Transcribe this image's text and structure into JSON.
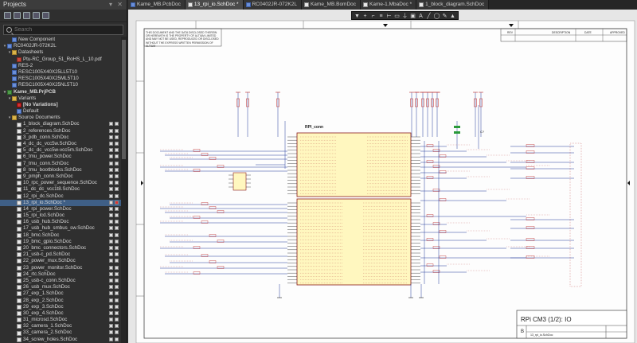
{
  "panel": {
    "title": "Projects",
    "search_placeholder": "Search",
    "rows": [
      {
        "text": "New Component",
        "indent": 1,
        "icon": "comp",
        "exp": ""
      },
      {
        "text": "RC0402JR-072K2L",
        "indent": 0,
        "icon": "comp",
        "exp": "▾"
      },
      {
        "text": "Datasheets",
        "indent": 1,
        "icon": "folder",
        "exp": "▾"
      },
      {
        "text": "Ptu-RC_Group_51_RoHS_L_10.pdf",
        "indent": 2,
        "icon": "pdf",
        "exp": ""
      },
      {
        "text": "RES-2",
        "indent": 1,
        "icon": "comp",
        "exp": ""
      },
      {
        "text": "RESC1005X40X25LL5T10",
        "indent": 1,
        "icon": "comp",
        "exp": ""
      },
      {
        "text": "RESC1005X40X25ML5T10",
        "indent": 1,
        "icon": "comp",
        "exp": ""
      },
      {
        "text": "RESC1005X40X25NL5T10",
        "indent": 1,
        "icon": "comp",
        "exp": ""
      },
      {
        "text": "Kame_MB.PrjPCB",
        "indent": 0,
        "icon": "proj",
        "exp": "▾",
        "proj": true
      },
      {
        "text": "Variants",
        "indent": 1,
        "icon": "folder",
        "exp": "▾"
      },
      {
        "text": "[No Variations]",
        "indent": 2,
        "icon": "red",
        "exp": "",
        "bold": true
      },
      {
        "text": "Default",
        "indent": 2,
        "icon": "comp",
        "exp": ""
      },
      {
        "text": "Source Documents",
        "indent": 1,
        "icon": "folder",
        "exp": "▾"
      },
      {
        "text": "1_block_diagram.SchDoc",
        "indent": 2,
        "icon": "doc",
        "flags": true
      },
      {
        "text": "2_references.SchDoc",
        "indent": 2,
        "icon": "doc",
        "flags": true
      },
      {
        "text": "3_pdb_conn.SchDoc",
        "indent": 2,
        "icon": "doc",
        "flags": true
      },
      {
        "text": "4_dc_dc_vcc5w.SchDoc",
        "indent": 2,
        "icon": "doc",
        "flags": true
      },
      {
        "text": "5_dc_dc_vcc5w-vcc5m.SchDoc",
        "indent": 2,
        "icon": "doc",
        "flags": true
      },
      {
        "text": "6_tmu_power.SchDoc",
        "indent": 2,
        "icon": "doc",
        "flags": true
      },
      {
        "text": "7_tmu_conn.SchDoc",
        "indent": 2,
        "icon": "doc",
        "flags": true
      },
      {
        "text": "8_tmu_bootblocks.SchDoc",
        "indent": 2,
        "icon": "doc",
        "flags": true
      },
      {
        "text": "9_pmph_conn.SchDoc",
        "indent": 2,
        "icon": "doc",
        "flags": true
      },
      {
        "text": "10_rpc_power_sequence.SchDoc",
        "indent": 2,
        "icon": "doc",
        "flags": true
      },
      {
        "text": "11_dc_dc_vcc1t8.SchDoc",
        "indent": 2,
        "icon": "doc",
        "flags": true
      },
      {
        "text": "12_rpi_dc.SchDoc",
        "indent": 2,
        "icon": "doc",
        "flags": true
      },
      {
        "text": "13_rpi_io.SchDoc *",
        "indent": 2,
        "icon": "doc",
        "flags": true,
        "sel": true
      },
      {
        "text": "14_rpi_power.SchDoc",
        "indent": 2,
        "icon": "doc",
        "flags": true
      },
      {
        "text": "15_rpi_lcd.SchDoc",
        "indent": 2,
        "icon": "doc",
        "flags": true
      },
      {
        "text": "16_usb_hub.SchDoc",
        "indent": 2,
        "icon": "doc",
        "flags": true
      },
      {
        "text": "17_usb_hub_smbus_sw.SchDoc",
        "indent": 2,
        "icon": "doc",
        "flags": true
      },
      {
        "text": "18_bmc.SchDoc",
        "indent": 2,
        "icon": "doc",
        "flags": true
      },
      {
        "text": "19_bmc_gpio.SchDoc",
        "indent": 2,
        "icon": "doc",
        "flags": true
      },
      {
        "text": "20_bmc_connectors.SchDoc",
        "indent": 2,
        "icon": "doc",
        "flags": true
      },
      {
        "text": "21_usb-c_pd.SchDoc",
        "indent": 2,
        "icon": "doc",
        "flags": true
      },
      {
        "text": "22_power_mux.SchDoc",
        "indent": 2,
        "icon": "doc",
        "flags": true
      },
      {
        "text": "23_power_monitor.SchDoc",
        "indent": 2,
        "icon": "doc",
        "flags": true
      },
      {
        "text": "24_rtc.SchDoc",
        "indent": 2,
        "icon": "doc",
        "flags": true
      },
      {
        "text": "25_usb-c_conn.SchDoc",
        "indent": 2,
        "icon": "doc",
        "flags": true
      },
      {
        "text": "26_usb_mux.SchDoc",
        "indent": 2,
        "icon": "doc",
        "flags": true
      },
      {
        "text": "27_exp_1.SchDoc",
        "indent": 2,
        "icon": "doc",
        "flags": true
      },
      {
        "text": "28_exp_2.SchDoc",
        "indent": 2,
        "icon": "doc",
        "flags": true
      },
      {
        "text": "29_exp_3.SchDoc",
        "indent": 2,
        "icon": "doc",
        "flags": true
      },
      {
        "text": "30_exp_4.SchDoc",
        "indent": 2,
        "icon": "doc",
        "flags": true
      },
      {
        "text": "31_microsd.SchDoc",
        "indent": 2,
        "icon": "doc",
        "flags": true
      },
      {
        "text": "32_camera_1.SchDoc",
        "indent": 2,
        "icon": "doc",
        "flags": true
      },
      {
        "text": "33_camera_2.SchDoc",
        "indent": 2,
        "icon": "doc",
        "flags": true
      },
      {
        "text": "34_screw_holes.SchDoc",
        "indent": 2,
        "icon": "doc",
        "flags": true
      }
    ]
  },
  "tabs": [
    {
      "label": "Kame_MB.PcbDoc",
      "icon": "comp"
    },
    {
      "label": "13_rpi_io.SchDoc *",
      "icon": "doc",
      "active": true
    },
    {
      "label": "RC0402JR-072K2L",
      "icon": "comp"
    },
    {
      "label": "Kame_MB.BomDoc",
      "icon": "doc"
    },
    {
      "label": "Kame-1.MbaDoc *",
      "icon": "doc"
    },
    {
      "label": "1_block_diagram.SchDoc",
      "icon": "doc"
    }
  ],
  "toolbar_icons": [
    "filter-icon",
    "add-icon",
    "wire-icon",
    "bus-icon",
    "net-icon",
    "port-icon",
    "power-icon",
    "part-icon",
    "text-icon",
    "line-icon",
    "shape-icon",
    "note-icon",
    "arrow-icon"
  ],
  "toolbar_glyphs": [
    "▼",
    "+",
    "⌐",
    "≡",
    "⊢",
    "▭",
    "⏚",
    "▣",
    "A",
    "╱",
    "◯",
    "✎",
    "▲"
  ],
  "sheet": {
    "component_designator": "RPI_conn",
    "notice": "THIS DOCUMENT AND THE DATA DISCLOSED THEREIN OR HEREWITH IS THE PROPERTY OF ALTIUM LIMITED AND MAY NOT BE USED, REPRODUCED OR DISCLOSED WITHOUT THE EXPRESS WRITTEN PERMISSION OF ALTIUM",
    "title": "RPi CM3 (1/2): IO",
    "sheet_letter": "B",
    "filename": "13_rpi_io.SchDoc",
    "revision_header": [
      "REV",
      "DESCRIPTION",
      "DATE",
      "APPROVED"
    ],
    "cap_label": "C?",
    "grid_letters": [
      "A",
      "B",
      "C",
      "D"
    ]
  }
}
